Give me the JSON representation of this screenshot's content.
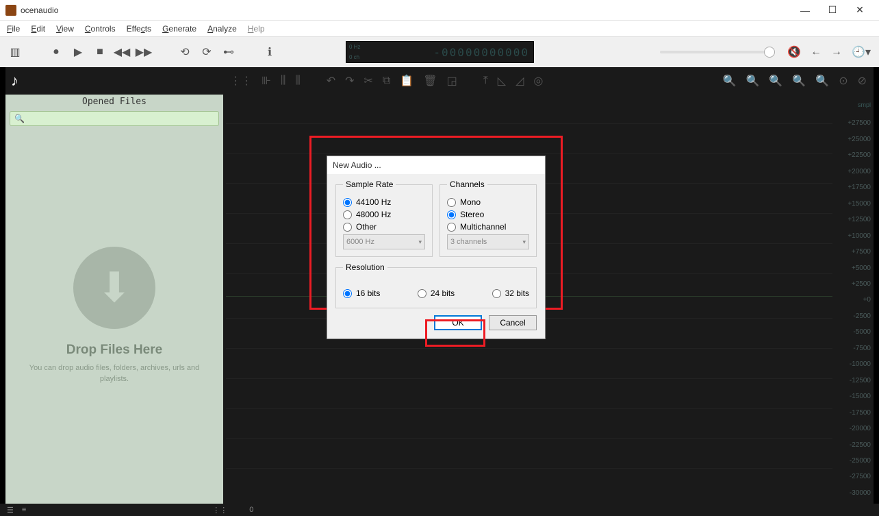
{
  "app": {
    "title": "ocenaudio"
  },
  "menu": {
    "file": "File",
    "edit": "Edit",
    "view": "View",
    "controls": "Controls",
    "effects": "Effects",
    "generate": "Generate",
    "analyze": "Analyze",
    "help": "Help"
  },
  "level": {
    "top": "0 Hz",
    "bot": "0 ch",
    "digits": "-00000000000"
  },
  "sidebar": {
    "header": "Opened Files",
    "drop_h": "Drop Files Here",
    "drop_p": "You can drop audio files, folders, archives, urls and playlists."
  },
  "statusbar": {
    "zero": "0"
  },
  "ruler": {
    "label": "smpl",
    "ticks": [
      "+27500",
      "+25000",
      "+22500",
      "+20000",
      "+17500",
      "+15000",
      "+12500",
      "+10000",
      "+7500",
      "+5000",
      "+2500",
      "+0",
      "-2500",
      "-5000",
      "-7500",
      "-10000",
      "-12500",
      "-15000",
      "-17500",
      "-20000",
      "-22500",
      "-25000",
      "-27500",
      "-30000"
    ]
  },
  "dialog": {
    "title": "New Audio ...",
    "sample_rate": {
      "legend": "Sample Rate",
      "opt1": "44100 Hz",
      "opt2": "48000 Hz",
      "opt3": "Other",
      "combo": "6000 Hz"
    },
    "channels": {
      "legend": "Channels",
      "opt1": "Mono",
      "opt2": "Stereo",
      "opt3": "Multichannel",
      "combo": "3 channels"
    },
    "resolution": {
      "legend": "Resolution",
      "opt1": "16 bits",
      "opt2": "24 bits",
      "opt3": "32 bits"
    },
    "ok": "OK",
    "cancel": "Cancel"
  }
}
